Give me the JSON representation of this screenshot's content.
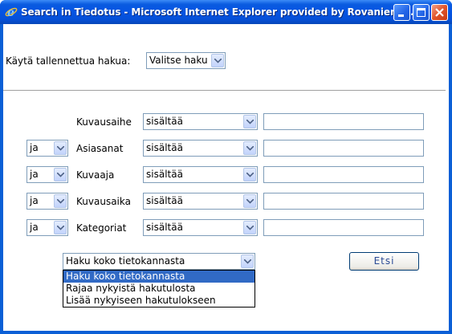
{
  "window": {
    "title": "Search in Tiedotus - Microsoft Internet Explorer provided by Rovanieme..."
  },
  "saved_search": {
    "label": "Käytä tallennettua hakua:",
    "select_value": "Valitse haku"
  },
  "criteria": [
    {
      "connector": "",
      "field": "Kuvausaihe",
      "operator": "sisältää",
      "value": ""
    },
    {
      "connector": "ja",
      "field": "Asiasanat",
      "operator": "sisältää",
      "value": ""
    },
    {
      "connector": "ja",
      "field": "Kuvaaja",
      "operator": "sisältää",
      "value": ""
    },
    {
      "connector": "ja",
      "field": "Kuvausaika",
      "operator": "sisältää",
      "value": ""
    },
    {
      "connector": "ja",
      "field": "Kategoriat",
      "operator": "sisältää",
      "value": ""
    }
  ],
  "scope": {
    "selected": "Haku koko tietokannasta",
    "options": [
      "Haku koko tietokannasta",
      "Rajaa nykyistä hakutulosta",
      "Lisää nykyiseen hakutulokseen"
    ]
  },
  "search_button": "Etsi",
  "colors": {
    "titlebar": "#0554e3",
    "selection": "#316ac5",
    "close_button": "#e0542a"
  }
}
